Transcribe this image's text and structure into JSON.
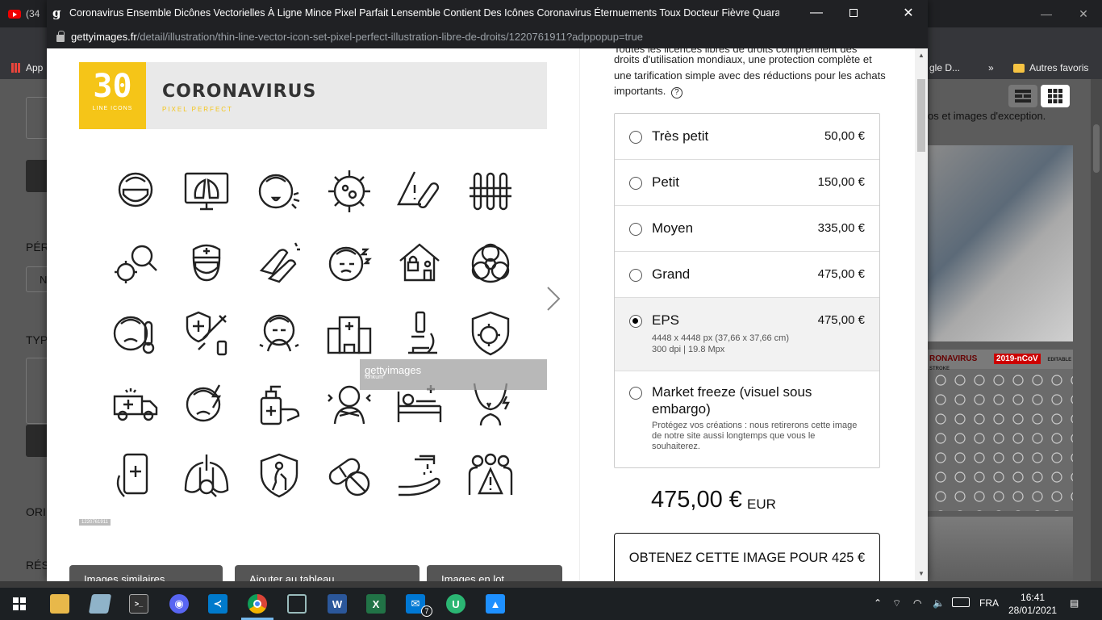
{
  "background_browser": {
    "tab_label": "(34",
    "bookmarks": [
      "App",
      "gle D...",
      "»",
      "Autres favoris"
    ],
    "left_labels": [
      "PÉR",
      "TYP",
      "ORI",
      "RÉS"
    ],
    "left_field_value": "N",
    "right_text": "os et images d'exception.",
    "icons_thumb_title": "RONAVIRUS",
    "icons_thumb_tag": "2019-nCoV",
    "icons_thumb_badge": "EDITABLE STROKE"
  },
  "popup": {
    "title": "Coronavirus Ensemble Dicônes Vectorielles À Ligne Mince Pixel Parfait Lensemble Contient Des Icônes Coronavirus Éternuements Toux Docteur Fièvre Quarantaine Rhume Et...",
    "url_host": "gettyimages.fr",
    "url_path": "/detail/illustration/thin-line-vector-icon-set-pixel-perfect-illustration-libre-de-droits/1220761911?adppopup=true",
    "preview": {
      "badge_number": "30",
      "badge_sub": "LINE ICONS",
      "title": "CORONAVIRUS",
      "subtitle": "PIXEL PERFECT",
      "watermark": "gettyimages",
      "watermark_sub": "fonkum",
      "image_id": "1220761911"
    },
    "bottom_buttons": [
      "Images similaires",
      "Ajouter au tableau",
      "Images en lot"
    ],
    "license_text_cut": "Toutes les licences libres de droits comprennent des",
    "license_text": "droits d'utilisation mondiaux, une protection complète et une tarification simple avec des réductions pour les achats importants.",
    "help_icon": "?",
    "sizes": [
      {
        "name": "Très petit",
        "price": "50,00 €"
      },
      {
        "name": "Petit",
        "price": "150,00 €"
      },
      {
        "name": "Moyen",
        "price": "335,00 €"
      },
      {
        "name": "Grand",
        "price": "475,00 €"
      },
      {
        "name": "EPS",
        "price": "475,00 €",
        "meta1": "4448 x 4448 px (37,66 x 37,66 cm)",
        "meta2": "300 dpi | 19.8 Mpx"
      },
      {
        "name": "Market freeze (visuel sous embargo)",
        "price": "",
        "meta1": "Protégez vos créations : nous retirerons cette image de notre site aussi longtemps que vous le souhaiterez."
      }
    ],
    "selected_size": "EPS",
    "total_price": "475,00 €",
    "currency": "EUR",
    "cta_label": "OBTENEZ CETTE IMAGE POUR 425 €"
  },
  "taskbar": {
    "language": "FRA",
    "time": "16:41",
    "date": "28/01/2021",
    "mail_badge": "7"
  },
  "colors": {
    "accent_yellow": "#f5c518",
    "popup_titlebar": "#202124",
    "taskbar": "#1c2023"
  }
}
